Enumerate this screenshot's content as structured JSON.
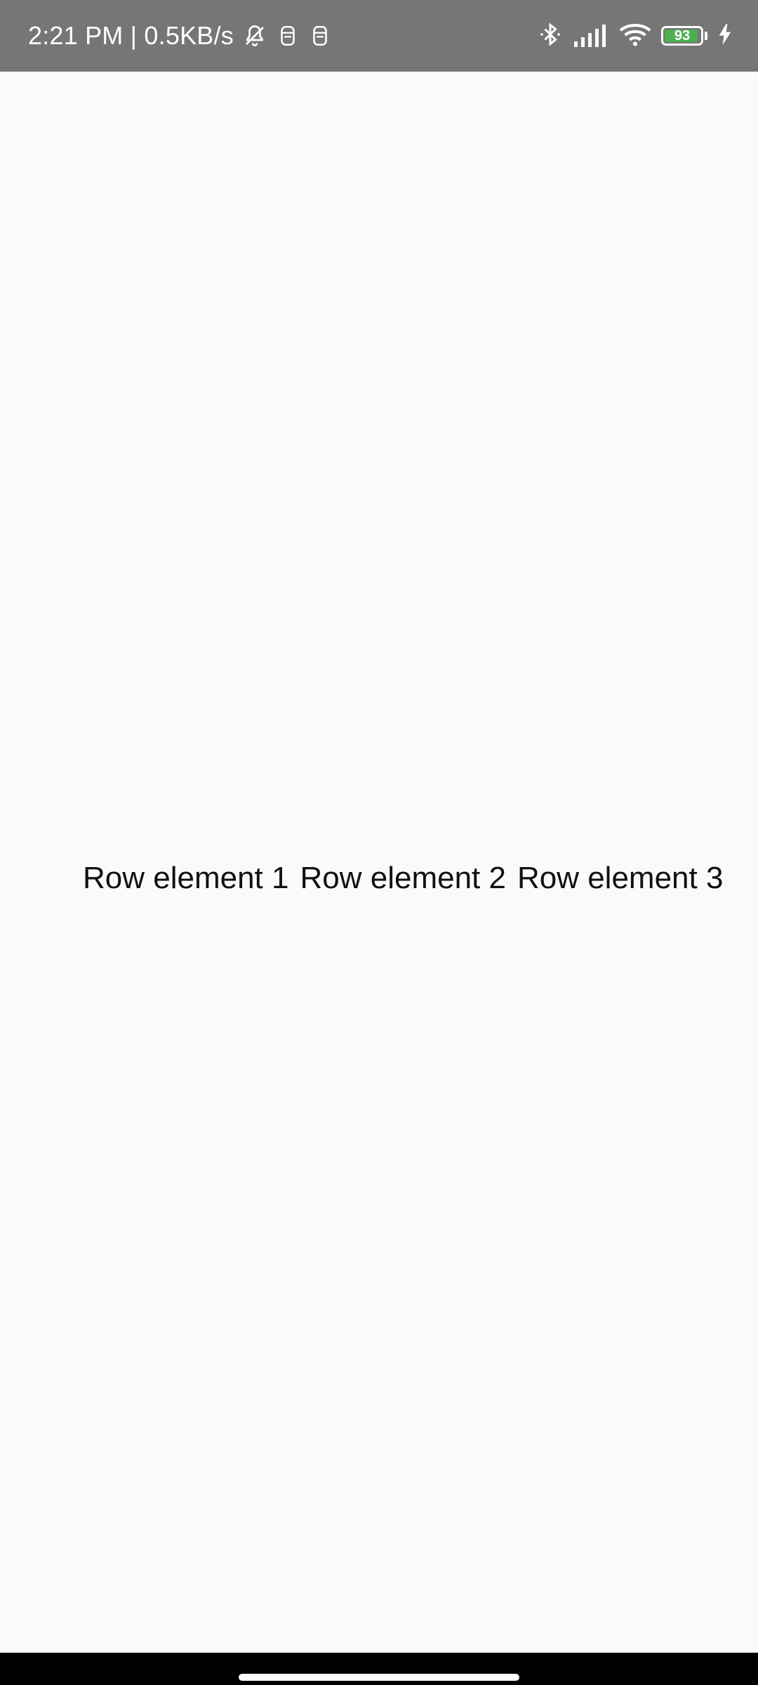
{
  "status_bar": {
    "time_speed": "2:21 PM | 0.5KB/s",
    "battery_level": "93",
    "battery_percent": 93,
    "icons": [
      "silent-bell-icon",
      "sim-icon",
      "sim-icon",
      "bluetooth-icon",
      "signal-icon",
      "wifi-icon",
      "battery-icon",
      "charging-bolt-icon"
    ],
    "colors": {
      "background": "#767676",
      "battery_fill": "#4caf50"
    }
  },
  "main": {
    "row_items": [
      "Row element 1",
      "Row element 2",
      "Row element 3"
    ]
  },
  "nav_bar": {
    "colors": {
      "background": "#000000",
      "indicator": "#ffffff"
    }
  }
}
